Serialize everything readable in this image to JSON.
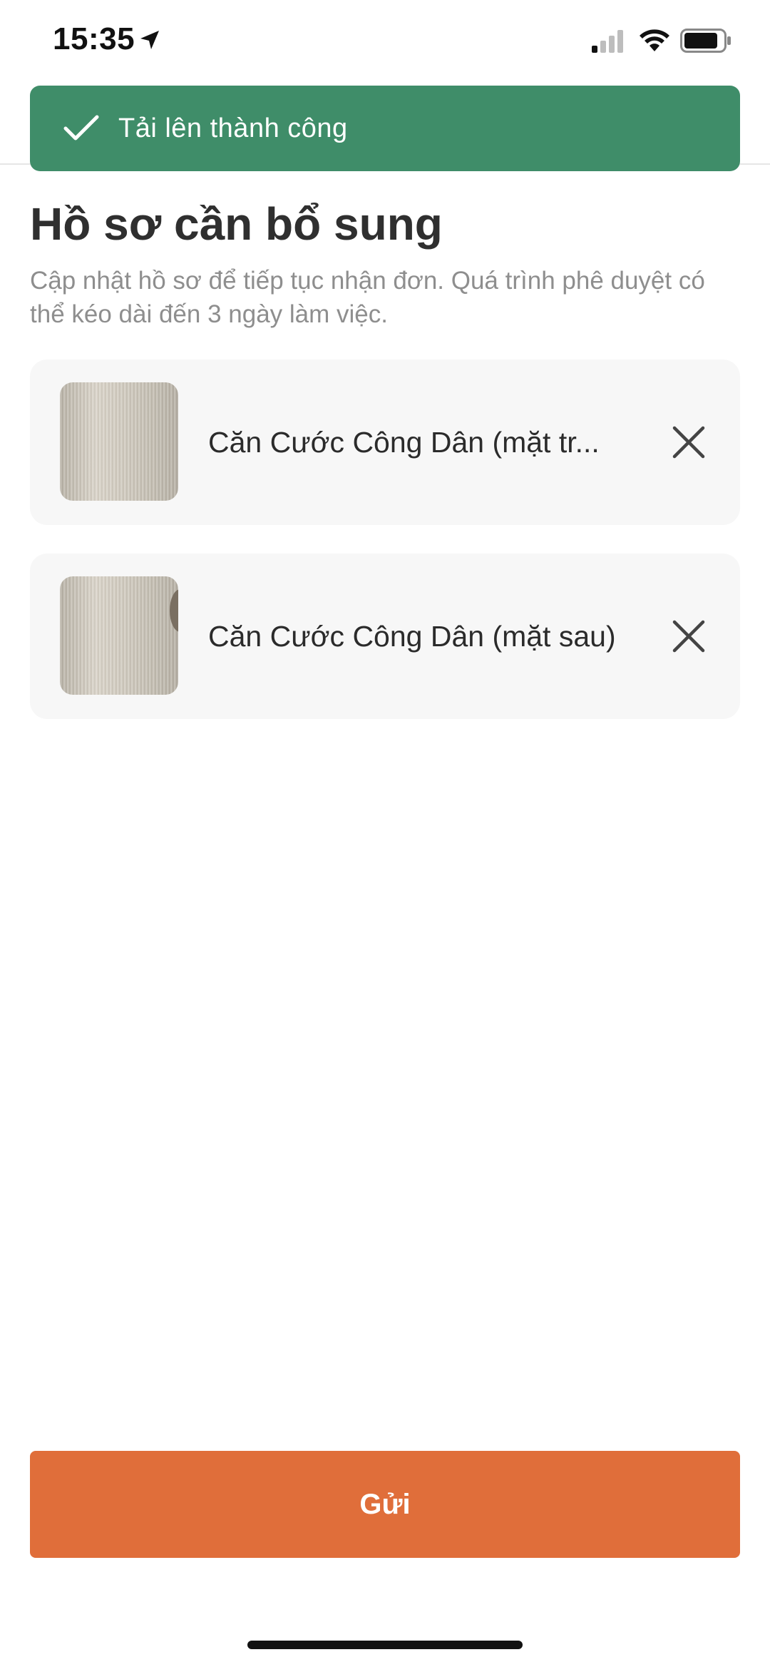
{
  "status_bar": {
    "time": "15:35"
  },
  "toast": {
    "message": "Tải lên thành công",
    "icon": "checkmark-icon",
    "color": "#3f8d69"
  },
  "header": {
    "title": "Hồ sơ cần bổ sung",
    "subtitle": "Cập nhật hồ sơ để tiếp tục nhận đơn. Quá trình phê duyệt có thể kéo dài đến 3 ngày làm việc."
  },
  "documents": [
    {
      "label": "Căn Cước Công Dân (mặt tr...",
      "remove_icon": "close-icon"
    },
    {
      "label": "Căn Cước Công Dân (mặt sau)",
      "remove_icon": "close-icon"
    }
  ],
  "submit": {
    "label": "Gửi",
    "color": "#e06e3a"
  }
}
